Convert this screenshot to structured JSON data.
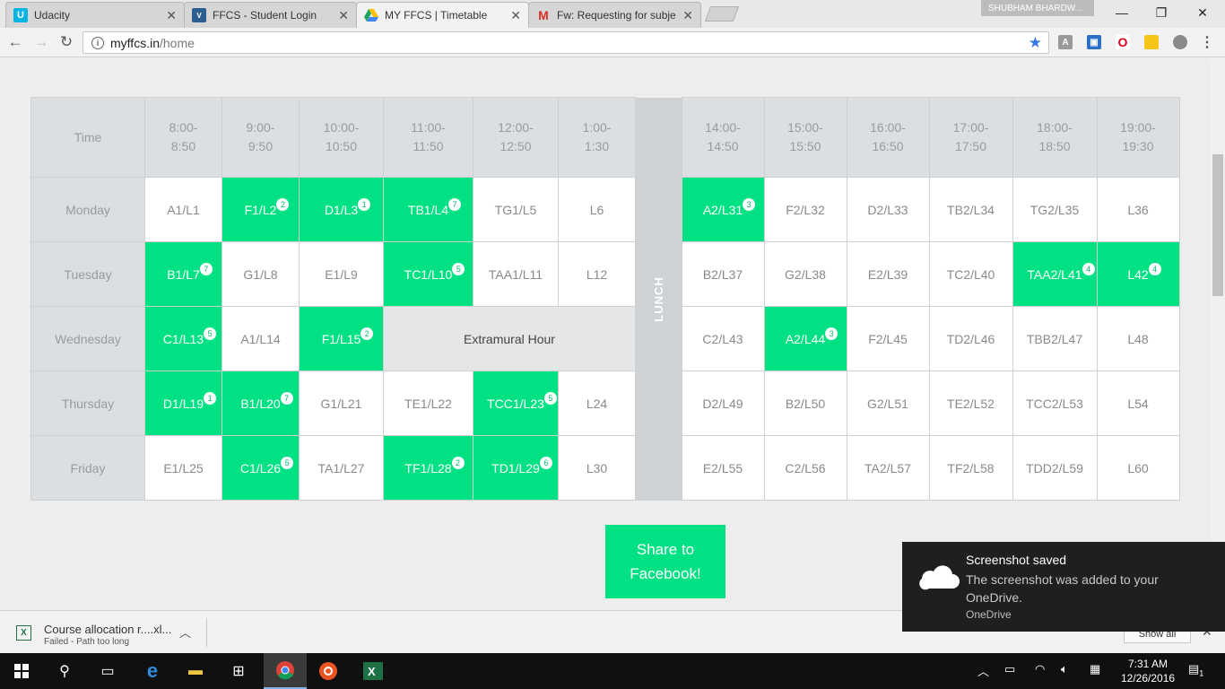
{
  "browser": {
    "tabs": [
      {
        "title": "Udacity",
        "favicon": "udacity-icon"
      },
      {
        "title": "FFCS - Student Login",
        "favicon": "vit-logo-icon"
      },
      {
        "title": "MY FFCS | Timetable",
        "favicon": "google-drive-icon"
      },
      {
        "title": "Fw: Requesting for subje",
        "favicon": "gmail-icon"
      }
    ],
    "profile_name": "SHUBHAM BHARDW...",
    "url_host": "myffcs.in",
    "url_path": "/home"
  },
  "timetable": {
    "time_header": "Time",
    "lunch_label": "LUNCH",
    "slots_am": [
      "8:00-\n8:50",
      "9:00-\n9:50",
      "10:00-\n10:50",
      "11:00-\n11:50",
      "12:00-\n12:50",
      "1:00-\n1:30"
    ],
    "slots_pm": [
      "14:00-\n14:50",
      "15:00-\n15:50",
      "16:00-\n16:50",
      "17:00-\n17:50",
      "18:00-\n18:50",
      "19:00-\n19:30"
    ],
    "rows": [
      {
        "day": "Monday",
        "am": [
          {
            "label": "A1/L1"
          },
          {
            "label": "F1/L2",
            "badge": "2"
          },
          {
            "label": "D1/L3",
            "badge": "1"
          },
          {
            "label": "TB1/L4",
            "badge": "7"
          },
          {
            "label": "TG1/L5"
          },
          {
            "label": "L6"
          }
        ],
        "pm": [
          {
            "label": "A2/L31",
            "badge": "3"
          },
          {
            "label": "F2/L32"
          },
          {
            "label": "D2/L33"
          },
          {
            "label": "TB2/L34"
          },
          {
            "label": "TG2/L35"
          },
          {
            "label": "L36"
          }
        ]
      },
      {
        "day": "Tuesday",
        "am": [
          {
            "label": "B1/L7",
            "badge": "7"
          },
          {
            "label": "G1/L8"
          },
          {
            "label": "E1/L9"
          },
          {
            "label": "TC1/L10",
            "badge": "5"
          },
          {
            "label": "TAA1/L11"
          },
          {
            "label": "L12"
          }
        ],
        "pm": [
          {
            "label": "B2/L37"
          },
          {
            "label": "G2/L38"
          },
          {
            "label": "E2/L39"
          },
          {
            "label": "TC2/L40"
          },
          {
            "label": "TAA2/L41",
            "badge": "4"
          },
          {
            "label": "L42",
            "badge": "4"
          }
        ]
      },
      {
        "day": "Wednesday",
        "am": [
          {
            "label": "C1/L13",
            "badge": "5"
          },
          {
            "label": "A1/L14"
          },
          {
            "label": "F1/L15",
            "badge": "2"
          }
        ],
        "extramural": "Extramural Hour",
        "pm": [
          {
            "label": "C2/L43"
          },
          {
            "label": "A2/L44",
            "badge": "3"
          },
          {
            "label": "F2/L45"
          },
          {
            "label": "TD2/L46"
          },
          {
            "label": "TBB2/L47"
          },
          {
            "label": "L48"
          }
        ]
      },
      {
        "day": "Thursday",
        "am": [
          {
            "label": "D1/L19",
            "badge": "1"
          },
          {
            "label": "B1/L20",
            "badge": "7"
          },
          {
            "label": "G1/L21"
          },
          {
            "label": "TE1/L22"
          },
          {
            "label": "TCC1/L23",
            "badge": "5"
          },
          {
            "label": "L24"
          }
        ],
        "pm": [
          {
            "label": "D2/L49"
          },
          {
            "label": "B2/L50"
          },
          {
            "label": "G2/L51"
          },
          {
            "label": "TE2/L52"
          },
          {
            "label": "TCC2/L53"
          },
          {
            "label": "L54"
          }
        ]
      },
      {
        "day": "Friday",
        "am": [
          {
            "label": "E1/L25"
          },
          {
            "label": "C1/L26",
            "badge": "5"
          },
          {
            "label": "TA1/L27"
          },
          {
            "label": "TF1/L28",
            "badge": "2"
          },
          {
            "label": "TD1/L29",
            "badge": "6"
          },
          {
            "label": "L30"
          }
        ],
        "pm": [
          {
            "label": "E2/L55"
          },
          {
            "label": "C2/L56"
          },
          {
            "label": "TA2/L57"
          },
          {
            "label": "TF2/L58"
          },
          {
            "label": "TDD2/L59"
          },
          {
            "label": "L60"
          }
        ]
      }
    ]
  },
  "share_button": "Share to\nFacebook!",
  "downloads": {
    "file_name": "Course allocation r....xl...",
    "status": "Failed - Path too long",
    "show_all": "Show all"
  },
  "toast": {
    "title": "Screenshot saved",
    "body": "The screenshot was added to your OneDrive.",
    "source": "OneDrive"
  },
  "taskbar": {
    "time": "7:31 AM",
    "date": "12/26/2016",
    "notification_count": "1"
  },
  "colors": {
    "selected": "#00e183",
    "header_bg": "#dcdfe2",
    "lunch_bg": "#cfd2d5"
  }
}
